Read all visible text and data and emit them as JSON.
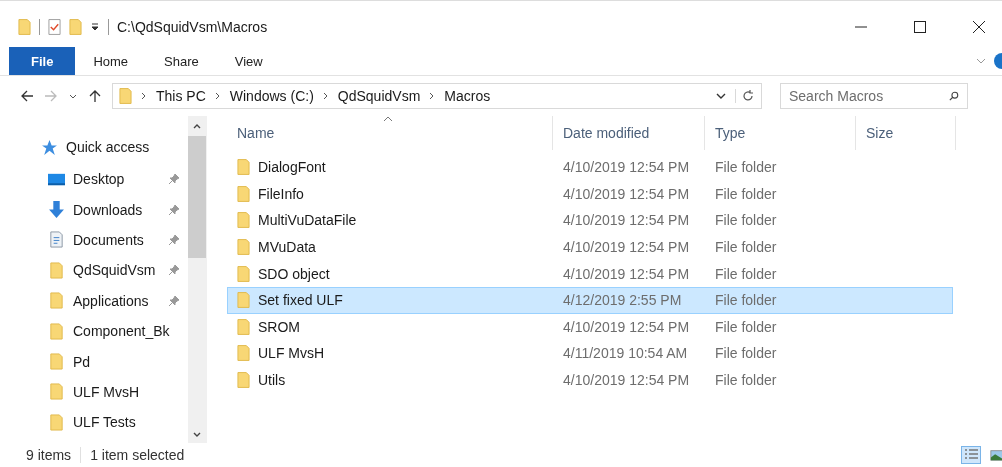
{
  "window": {
    "title": "C:\\QdSquidVsm\\Macros"
  },
  "ribbon_tabs": [
    {
      "label": "File",
      "selected": true
    },
    {
      "label": "Home",
      "selected": false
    },
    {
      "label": "Share",
      "selected": false
    },
    {
      "label": "View",
      "selected": false
    }
  ],
  "address": {
    "crumbs": [
      "This PC",
      "Windows (C:)",
      "QdSquidVsm",
      "Macros"
    ]
  },
  "search": {
    "placeholder": "Search Macros"
  },
  "sidebar": {
    "items": [
      {
        "label": "Quick access",
        "kind": "star",
        "pinned": false
      },
      {
        "label": "Desktop",
        "kind": "desktop",
        "pinned": true
      },
      {
        "label": "Downloads",
        "kind": "download",
        "pinned": true
      },
      {
        "label": "Documents",
        "kind": "document",
        "pinned": true
      },
      {
        "label": "QdSquidVsm",
        "kind": "folder",
        "pinned": true
      },
      {
        "label": "Applications",
        "kind": "folder",
        "pinned": true
      },
      {
        "label": "Component_Bk",
        "kind": "folder",
        "pinned": false
      },
      {
        "label": "Pd",
        "kind": "folder",
        "pinned": false
      },
      {
        "label": "ULF MvsH",
        "kind": "folder",
        "pinned": false
      },
      {
        "label": "ULF Tests",
        "kind": "folder",
        "pinned": false
      }
    ]
  },
  "table": {
    "columns": [
      "Name",
      "Date modified",
      "Type",
      "Size"
    ],
    "rows": [
      {
        "name": "DialogFont",
        "date": "4/10/2019 12:54 PM",
        "type": "File folder",
        "selected": false
      },
      {
        "name": "FileInfo",
        "date": "4/10/2019 12:54 PM",
        "type": "File folder",
        "selected": false
      },
      {
        "name": "MultiVuDataFile",
        "date": "4/10/2019 12:54 PM",
        "type": "File folder",
        "selected": false
      },
      {
        "name": "MVuData",
        "date": "4/10/2019 12:54 PM",
        "type": "File folder",
        "selected": false
      },
      {
        "name": "SDO object",
        "date": "4/10/2019 12:54 PM",
        "type": "File folder",
        "selected": false
      },
      {
        "name": "Set fixed ULF",
        "date": "4/12/2019 2:55 PM",
        "type": "File folder",
        "selected": true
      },
      {
        "name": "SROM",
        "date": "4/10/2019 12:54 PM",
        "type": "File folder",
        "selected": false
      },
      {
        "name": "ULF MvsH",
        "date": "4/11/2019 10:54 AM",
        "type": "File folder",
        "selected": false
      },
      {
        "name": "Utils",
        "date": "4/10/2019 12:54 PM",
        "type": "File folder",
        "selected": false
      }
    ]
  },
  "status_bar": {
    "count": "9 items",
    "selection": "1 item selected"
  }
}
